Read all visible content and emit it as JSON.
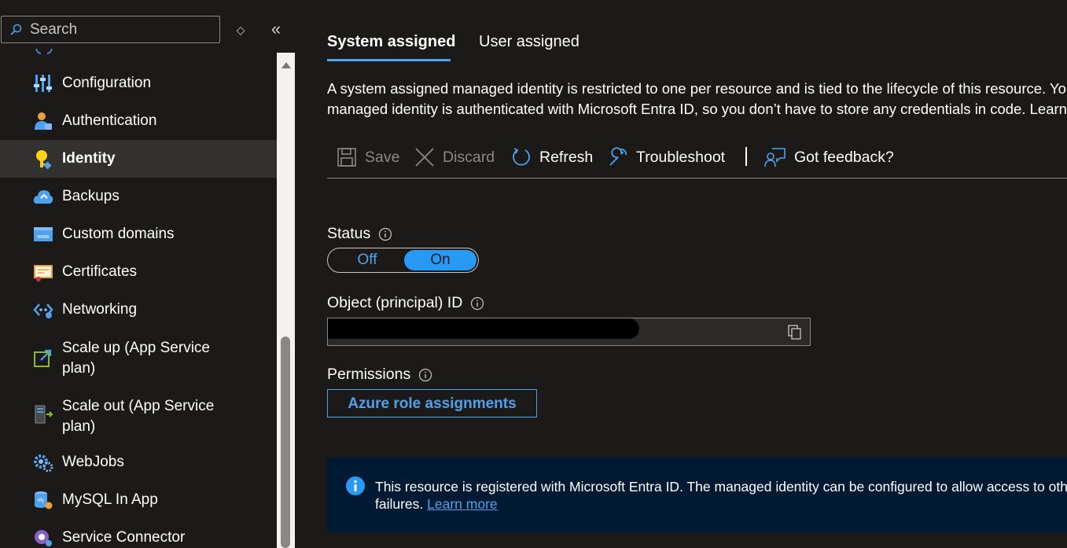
{
  "search": {
    "placeholder": "Search"
  },
  "sidebar": {
    "items": [
      {
        "label": "Configuration",
        "icon": "configuration-icon"
      },
      {
        "label": "Authentication",
        "icon": "authentication-icon"
      },
      {
        "label": "Identity",
        "icon": "identity-key-icon",
        "active": true
      },
      {
        "label": "Backups",
        "icon": "backups-cloud-icon"
      },
      {
        "label": "Custom domains",
        "icon": "custom-domains-www-icon"
      },
      {
        "label": "Certificates",
        "icon": "certificate-icon"
      },
      {
        "label": "Networking",
        "icon": "networking-icon"
      },
      {
        "label": "Scale up (App Service plan)",
        "icon": "scale-up-icon"
      },
      {
        "label": "Scale out (App Service plan)",
        "icon": "scale-out-icon"
      },
      {
        "label": "WebJobs",
        "icon": "webjobs-gear-icon"
      },
      {
        "label": "MySQL In App",
        "icon": "mysql-icon"
      },
      {
        "label": "Service Connector",
        "icon": "service-connector-icon"
      }
    ]
  },
  "tabs": [
    {
      "label": "System assigned",
      "active": true
    },
    {
      "label": "User assigned",
      "active": false
    }
  ],
  "description": {
    "line1": "A system assigned managed identity is restricted to one per resource and is tied to the lifecycle of this resource. You can grant permissions to the",
    "line2": "managed identity is authenticated with Microsoft Entra ID, so you don’t have to store any credentials in code. Learn more"
  },
  "toolbar": {
    "save": "Save",
    "discard": "Discard",
    "refresh": "Refresh",
    "troubleshoot": "Troubleshoot",
    "feedback": "Got feedback?"
  },
  "status": {
    "label": "Status",
    "off_label": "Off",
    "on_label": "On",
    "value": "On"
  },
  "object_id": {
    "label": "Object (principal) ID"
  },
  "permissions": {
    "label": "Permissions",
    "button": "Azure role assignments"
  },
  "banner": {
    "line1": "This resource is registered with Microsoft Entra ID. The managed identity can be configured to allow access to other resources. Be careful when making changes to the access settings for the managed identity because it can result in",
    "line2": "failures.",
    "link": "Learn more"
  },
  "colors": {
    "background": "#1b1a19",
    "accent": "#4fa1ee",
    "toggle_on": "#2899f5",
    "banner_bg": "#001a33"
  }
}
